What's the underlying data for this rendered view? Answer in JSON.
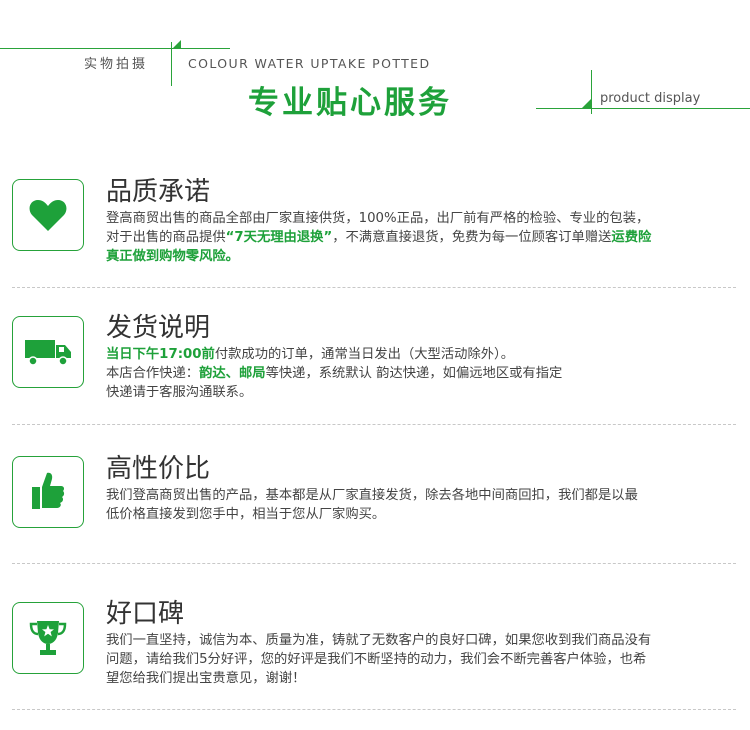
{
  "header": {
    "label_cn": "实物拍摄",
    "subtitle_en": "COLOUR WATER UPTAKE POTTED",
    "title": "专业贴心服务",
    "right_label": "product display"
  },
  "colors": {
    "accent": "#1ea13a",
    "line": "#2aa33a",
    "divider": "#c8c8c8",
    "text": "#444444"
  },
  "sections": [
    {
      "icon": "heart-icon",
      "title": "品质承诺",
      "lines": [
        [
          {
            "t": "登高商贸出售的商品全部由厂家直接供货，100%正品，出厂前有严格的检验、专业的包装，",
            "g": false
          }
        ],
        [
          {
            "t": "对于出售的商品提供",
            "g": false
          },
          {
            "t": "“7天无理由退换”",
            "g": true
          },
          {
            "t": "，不满意直接退货，免费为每一位顾客订单赠送",
            "g": false
          },
          {
            "t": "运费险",
            "g": true
          }
        ],
        [
          {
            "t": "真正做到购物零风险。",
            "g": true
          }
        ]
      ]
    },
    {
      "icon": "truck-icon",
      "title": "发货说明",
      "lines": [
        [
          {
            "t": "当日下午17:00前",
            "g": true
          },
          {
            "t": "付款成功的订单，通常当日发出（大型活动除外）。",
            "g": false
          }
        ],
        [
          {
            "t": "本店合作快递：",
            "g": false
          },
          {
            "t": "韵达、邮局",
            "g": true
          },
          {
            "t": "等快递，系统默认 韵达快递，如偏远地区或有指定",
            "g": false
          }
        ],
        [
          {
            "t": "快递请于客服沟通联系。",
            "g": false
          }
        ]
      ]
    },
    {
      "icon": "thumbs-up-icon",
      "title": "高性价比",
      "lines": [
        [
          {
            "t": "我们登高商贸出售的产品，基本都是从厂家直接发货，除去各地中间商回扣，我们都是以最",
            "g": false
          }
        ],
        [
          {
            "t": "低价格直接发到您手中，相当于您从厂家购买。",
            "g": false
          }
        ]
      ]
    },
    {
      "icon": "trophy-icon",
      "title": "好口碑",
      "lines": [
        [
          {
            "t": "我们一直坚持，诚信为本、质量为准，铸就了无数客户的良好口碑，如果您收到我们商品没有",
            "g": false
          }
        ],
        [
          {
            "t": "问题，请给我们5分好评，您的好评是我们不断坚持的动力，我们会不断完善客户体验，也希",
            "g": false
          }
        ],
        [
          {
            "t": "望您给我们提出宝贵意见，谢谢！",
            "g": false
          }
        ]
      ]
    }
  ]
}
